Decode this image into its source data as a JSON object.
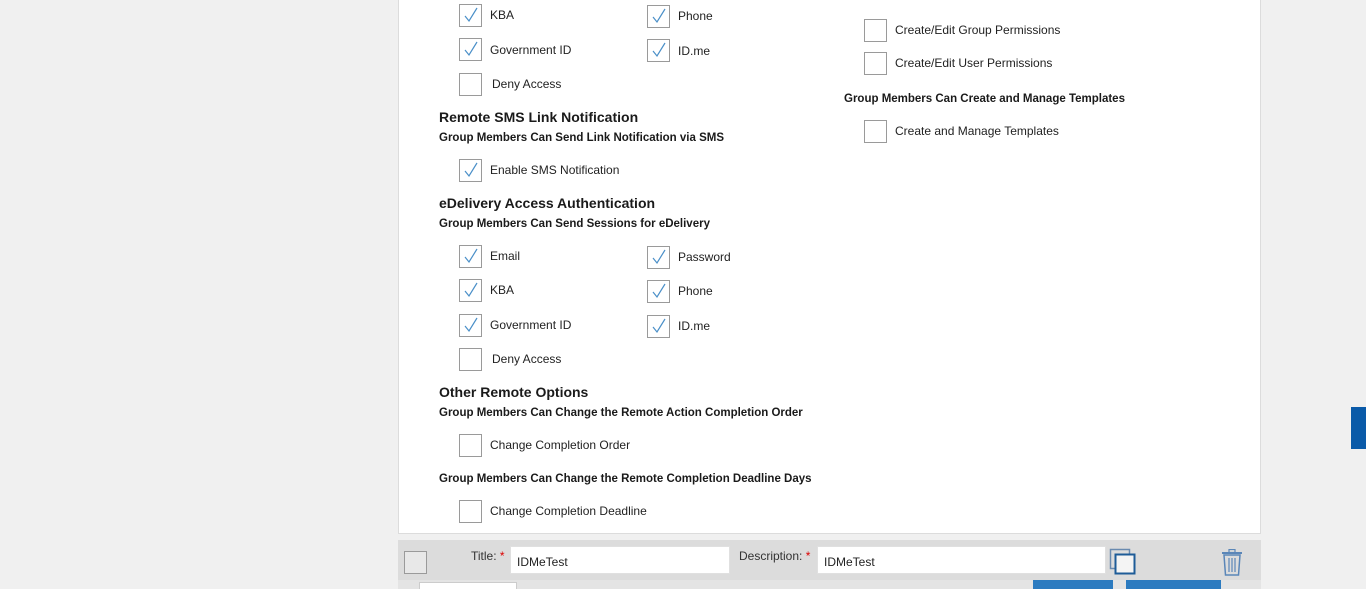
{
  "left_column": {
    "top_checks": [
      {
        "label": "KBA",
        "checked": true
      },
      {
        "label": "Phone",
        "checked": true
      },
      {
        "label": "Government ID",
        "checked": true
      },
      {
        "label": "ID.me",
        "checked": true
      },
      {
        "label": "Deny Access",
        "checked": false
      }
    ],
    "sms_section": {
      "title": "Remote SMS Link Notification",
      "subtitle": "Group Members Can Send Link Notification via SMS",
      "checks": [
        {
          "label": "Enable SMS Notification",
          "checked": true
        }
      ]
    },
    "edelivery_section": {
      "title": "eDelivery Access Authentication",
      "subtitle": "Group Members Can Send Sessions for eDelivery",
      "checks": [
        {
          "label": "Email",
          "checked": true
        },
        {
          "label": "Password",
          "checked": true
        },
        {
          "label": "KBA",
          "checked": true
        },
        {
          "label": "Phone",
          "checked": true
        },
        {
          "label": "Government ID",
          "checked": true
        },
        {
          "label": "ID.me",
          "checked": true
        },
        {
          "label": "Deny Access",
          "checked": false
        }
      ]
    },
    "other_section": {
      "title": "Other Remote Options",
      "subtitle1": "Group Members Can Change the Remote Action Completion Order",
      "check1": {
        "label": "Change Completion Order",
        "checked": false
      },
      "subtitle2": "Group Members Can Change the Remote Completion Deadline Days",
      "check2": {
        "label": "Change Completion Deadline",
        "checked": false
      }
    }
  },
  "right_column": {
    "permissions_checks": [
      {
        "label": "Create/Edit Group Permissions",
        "checked": false
      },
      {
        "label": "Create/Edit User Permissions",
        "checked": false
      }
    ],
    "templates_subtitle": "Group Members Can Create and Manage Templates",
    "templates_check": {
      "label": "Create and Manage Templates",
      "checked": false
    }
  },
  "bottom_bar": {
    "title_label": "Title:",
    "title_value": "IDMeTest",
    "description_label": "Description:",
    "description_value": "IDMeTest",
    "required_mark": "*"
  },
  "colors": {
    "accent": "#0a5aa8",
    "check": "#4a8fc8",
    "required": "#dd0000"
  }
}
